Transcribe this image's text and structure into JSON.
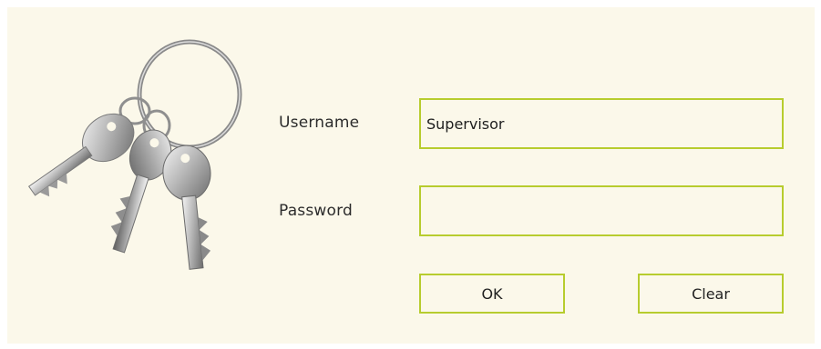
{
  "login": {
    "username_label": "Username",
    "password_label": "Password",
    "username_value": "Supervisor",
    "password_value": "",
    "ok_label": "OK",
    "clear_label": "Clear"
  },
  "icons": {
    "keys": "keys-icon"
  },
  "colors": {
    "background": "#fbf8ea",
    "field_border": "#b7cc2e"
  }
}
